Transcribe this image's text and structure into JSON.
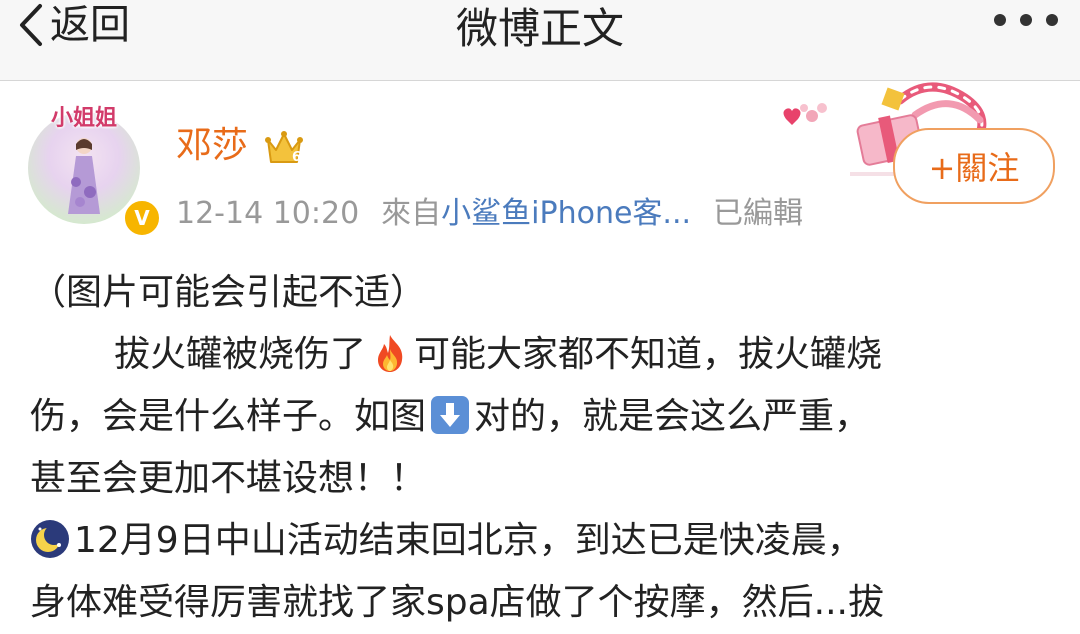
{
  "navbar": {
    "back_label": "返回",
    "title": "微博正文",
    "more_icon": "more-dots-icon"
  },
  "author": {
    "avatar_banner": "小姐姐",
    "name": "邓莎",
    "verified_badge": "V",
    "crown_level": "6"
  },
  "meta": {
    "time": "12-14 10:20",
    "from_label": "來自",
    "source": "小鲨鱼iPhone客...",
    "edited": "已編輯"
  },
  "follow_button": {
    "label": "+關注"
  },
  "post": {
    "line1": "（图片可能会引起不适）",
    "line2a": "拔火罐被烧伤了",
    "line2b": "可能大家都不知道，拔火罐烧",
    "line3a": "伤，会是什么样子。如图",
    "line3b": "对的，就是会这么严重，",
    "line4": "甚至会更加不堪设想！！",
    "line5": "12月9日中山活动结束回北京，到达已是快凌晨，",
    "line6": "身体难受得厉害就找了家spa店做了个按摩，然后...拔"
  },
  "colors": {
    "username": "#e86b19",
    "link": "#4b7bbd",
    "meta": "#999999",
    "follow_border": "#f0a060"
  }
}
